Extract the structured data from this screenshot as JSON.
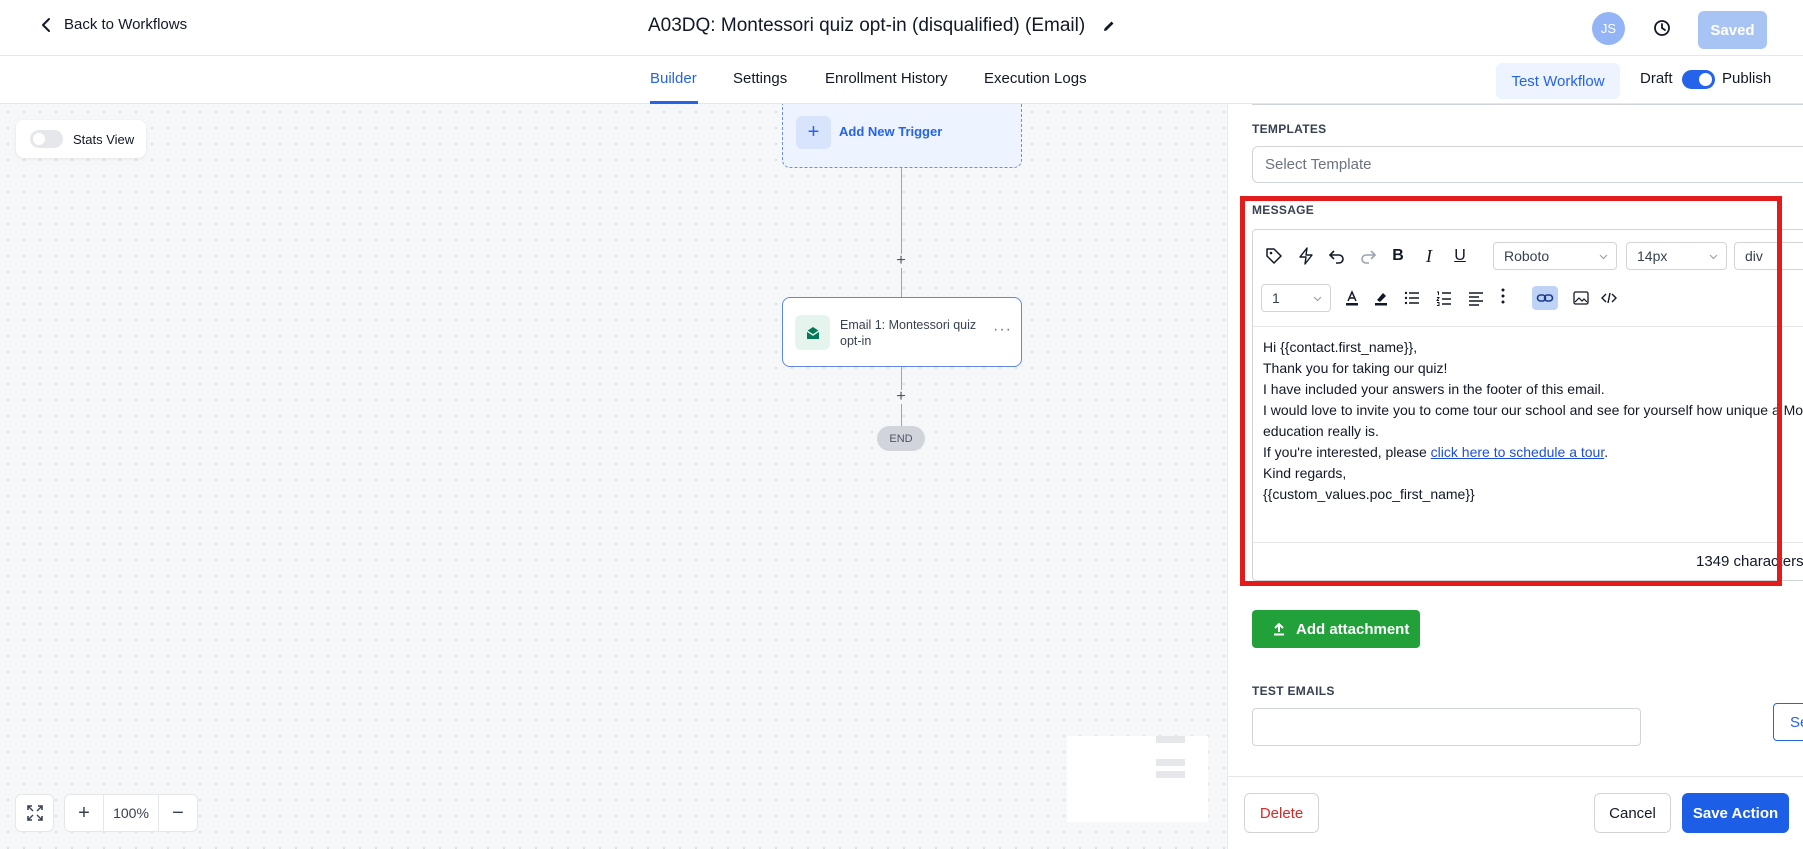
{
  "header": {
    "back_label": "Back to Workflows",
    "title": "A03DQ: Montessori quiz opt-in (disqualified) (Email)",
    "avatar_initials": "JS",
    "saved_label": "Saved"
  },
  "tabs": [
    {
      "label": "Builder",
      "active": true
    },
    {
      "label": "Settings"
    },
    {
      "label": "Enrollment History"
    },
    {
      "label": "Execution Logs"
    }
  ],
  "actions": {
    "test_workflow": "Test Workflow",
    "draft": "Draft",
    "publish": "Publish"
  },
  "canvas": {
    "stats_view": "Stats View",
    "add_trigger": "Add New Trigger",
    "email_node": "Email 1: Montessori quiz opt-in",
    "end": "END",
    "zoom_level": "100%"
  },
  "panel": {
    "templates_label": "TEMPLATES",
    "template_placeholder": "Select Template",
    "message_label": "MESSAGE",
    "toolbar": {
      "font": "Roboto",
      "size": "14px",
      "block": "div",
      "line_height": "1"
    },
    "message": {
      "line1": "Hi {{contact.first_name}},",
      "line2": "Thank you for taking our quiz!",
      "line3": "I have included your answers in the footer of this email.",
      "line4": "I would love to invite you to come tour our school and see for yourself how unique a Mon",
      "line5": "education really is.",
      "line6_pre": "If you're interested, please ",
      "line6_link": "click here to schedule a tour",
      "line6_post": ".",
      "line7": "Kind regards,",
      "line8": "{{custom_values.poc_first_name}}"
    },
    "char_count": "1349 characters",
    "add_attachment": "Add attachment",
    "test_emails_label": "TEST EMAILS",
    "send_label": "Se",
    "delete": "Delete",
    "cancel": "Cancel",
    "save_action": "Save Action"
  },
  "colors": {
    "accent": "#2563eb",
    "highlight_box": "#e31b1b",
    "attach_green": "#22a03a"
  }
}
